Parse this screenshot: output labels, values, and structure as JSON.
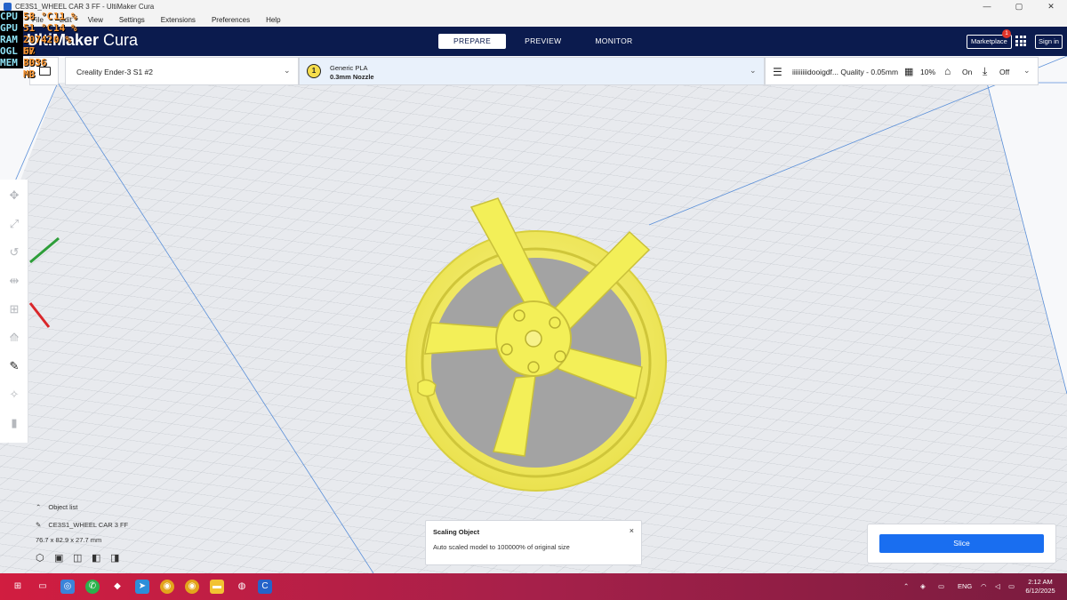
{
  "window": {
    "title": "CE3S1_WHEEL CAR 3 FF - UltiMaker Cura",
    "minimize": "—",
    "maximize": "▢",
    "close": "✕"
  },
  "menu": [
    {
      "label": "File"
    },
    {
      "label": "Edit"
    },
    {
      "label": "View"
    },
    {
      "label": "Settings"
    },
    {
      "label": "Extensions"
    },
    {
      "label": "Preferences"
    },
    {
      "label": "Help"
    }
  ],
  "fps_overlay": {
    "rows": [
      {
        "label": "CPU",
        "v1": "58 °C",
        "v2": "11 %"
      },
      {
        "label": "GPU",
        "v1": "51 °C",
        "v2": "14 %"
      },
      {
        "label": "RAM",
        "v1": "20742 MB",
        "v2": "0 %"
      },
      {
        "label": "OGL",
        "v1": "67 FPS",
        "v2": ""
      },
      {
        "label": "MEM",
        "v1": "3036 MB",
        "v2": ""
      }
    ]
  },
  "header": {
    "logo_main": "UltiMaker",
    "logo_sub": "Cura",
    "stages": [
      {
        "label": "PREPARE",
        "active": true
      },
      {
        "label": "PREVIEW",
        "active": false
      },
      {
        "label": "MONITOR",
        "active": false
      }
    ],
    "marketplace": "Marketplace",
    "marketplace_badge": "1",
    "signin": "Sign in"
  },
  "settings": {
    "printer": "Creality Ender-3 S1 #2",
    "extruder_number": "1",
    "material": "Generic PLA",
    "nozzle": "0.3mm Nozzle",
    "profile": "iiiiiiiiidooigdf... Quality - 0.05mm",
    "infill": "10%",
    "support": "On",
    "adhesion": "Off"
  },
  "object_list": {
    "title": "Object list",
    "name": "CE3S1_WHEEL CAR 3 FF",
    "dimensions": "76.7 x 82.9 x 27.7 mm"
  },
  "toast": {
    "title": "Scaling Object",
    "message": "Auto scaled model to 100000% of original size",
    "close": "×"
  },
  "slice": {
    "label": "Slice"
  },
  "taskbar": {
    "language": "ENG",
    "time": "2:12 AM",
    "date": "6/12/2025"
  },
  "colors": {
    "header_bg": "#0b1b4e",
    "model_yellow": "#f3ef58",
    "accent_blue": "#196ef0",
    "taskbar": "#c21f46"
  }
}
